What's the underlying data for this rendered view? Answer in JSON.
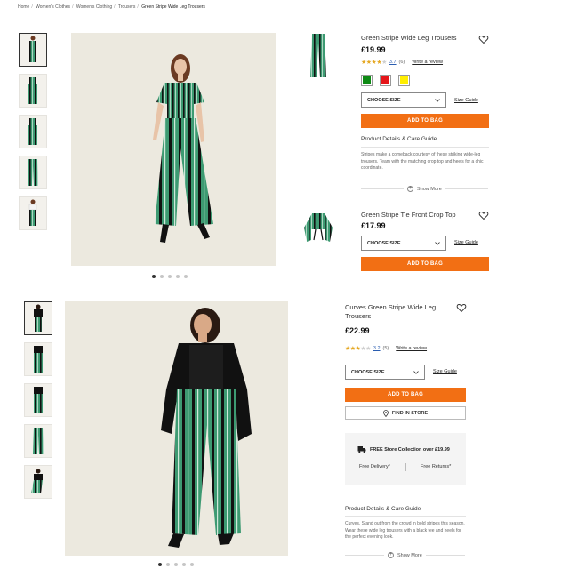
{
  "breadcrumb": [
    "Home",
    "Women's Clothes",
    "Women's Clothing",
    "Trousers",
    "Green Stripe Wide Leg Trousers"
  ],
  "colors": {
    "accent": "#f26f14",
    "stripe_green": "#3d9a72",
    "stripe_black": "#111111",
    "swatch_green": "#0d8a14",
    "swatch_red": "#e5161a",
    "swatch_yellow": "#ffee00",
    "star": "#e5a823",
    "link_blue": "#2a5db0"
  },
  "gallery1": {
    "thumb_count": 5,
    "active_index": 0,
    "dot_count": 5,
    "active_dot": 0
  },
  "product1": {
    "title": "Green Stripe Wide Leg Trousers",
    "price": "£19.99",
    "rating_stars": 3.7,
    "rating_score": "3.7",
    "rating_count": "(6)",
    "write_review": "Write a review",
    "swatch_colors": [
      "green",
      "red",
      "yellow"
    ],
    "size_select": "CHOOSE SIZE",
    "size_guide": "Size Guide",
    "add_to_bag": "ADD TO BAG",
    "details_title": "Product Details & Care Guide",
    "description": "Stripes make a comeback courtesy of these striking wide-leg trousers. Team with the matching crop top and heels for a chic coordinate.",
    "show_more": "Show More",
    "heart_icon": "heart-outline-icon"
  },
  "product2": {
    "title": "Green Stripe Tie Front Crop Top",
    "price": "£17.99",
    "size_select": "CHOOSE SIZE",
    "size_guide": "Size Guide",
    "add_to_bag": "ADD TO BAG",
    "heart_icon": "heart-outline-icon"
  },
  "gallery2": {
    "thumb_count": 5,
    "active_index": 0,
    "dot_count": 5,
    "active_dot": 0
  },
  "product3": {
    "title": "Curves Green Stripe Wide Leg Trousers",
    "price": "£22.99",
    "rating_stars": 3.2,
    "rating_score": "3.2",
    "rating_count": "(5)",
    "write_review": "Write a review",
    "size_select": "CHOOSE SIZE",
    "size_guide": "Size Guide",
    "add_to_bag": "ADD TO BAG",
    "find_in_store": "FIND IN STORE",
    "store_panel_text": "FREE Store Collection over £19.99",
    "free_delivery": "Free Delivery*",
    "free_returns": "Free Returns*",
    "details_title": "Product Details & Care Guide",
    "description": "Curves. Stand out from the crowd in bold stripes this season. Wear these wide leg trousers with a black tee and heels for the perfect evening look.",
    "show_more": "Show More",
    "heart_icon": "heart-outline-icon"
  }
}
